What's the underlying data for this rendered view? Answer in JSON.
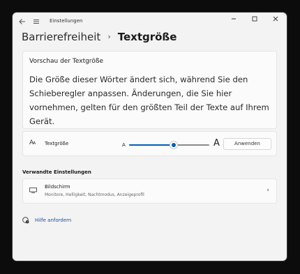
{
  "window": {
    "app_title": "Einstellungen"
  },
  "breadcrumb": {
    "parent": "Barrierefreiheit",
    "separator": "›",
    "current": "Textgröße"
  },
  "preview": {
    "heading": "Vorschau der Textgröße",
    "text": "Die Größe dieser Wörter ändert sich, während Sie den Schieberegler anpassen. Änderungen, die Sie hier vornehmen, gelten für den größten Teil der Texte auf Ihrem Gerät."
  },
  "text_size": {
    "icon": "text-size-icon",
    "label": "Textgröße",
    "slider_min_label": "A",
    "slider_max_label": "A",
    "slider_value_fraction": 0.56,
    "apply_label": "Anwenden"
  },
  "related": {
    "heading": "Verwandte Einstellungen",
    "display": {
      "icon": "monitor-icon",
      "title": "Bildschirm",
      "subtitle": "Monitore, Helligkeit, Nachtmodus, Anzeigeprofil"
    }
  },
  "help": {
    "icon": "help-icon",
    "label": "Hilfe anfordern"
  },
  "colors": {
    "accent": "#005fb8",
    "background": "#f3f3f3",
    "card": "#fbfbfb"
  }
}
